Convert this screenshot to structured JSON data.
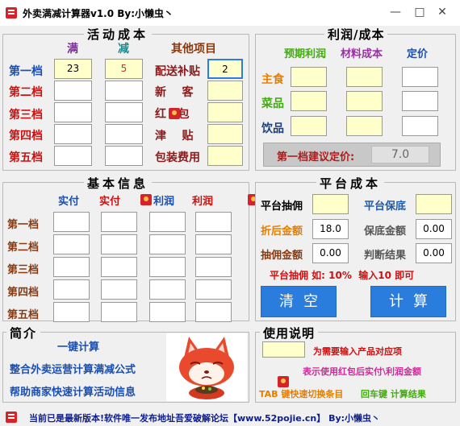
{
  "window": {
    "title": "外卖满减计算器v1.0    By:小懒虫丶",
    "minimize_glyph": "—",
    "maximize_glyph": "□",
    "close_glyph": "✕"
  },
  "activity_cost": {
    "title": "活动成本",
    "col_full": "满",
    "col_minus": "减",
    "col_other": "其他项目",
    "tiers": [
      {
        "label": "第一档",
        "full": "23",
        "minus": "5"
      },
      {
        "label": "第二档",
        "full": "",
        "minus": ""
      },
      {
        "label": "第三档",
        "full": "",
        "minus": ""
      },
      {
        "label": "第四档",
        "full": "",
        "minus": ""
      },
      {
        "label": "第五档",
        "full": "",
        "minus": ""
      }
    ],
    "other_items": [
      {
        "label": "配送补贴",
        "value": "2"
      },
      {
        "label": "新    客",
        "value": ""
      },
      {
        "label": "红   包",
        "value": ""
      },
      {
        "label": "津    贴",
        "value": ""
      },
      {
        "label": "包装费用",
        "value": ""
      }
    ]
  },
  "profit_cost": {
    "title": "利润/成本",
    "col_expected_profit": "预期利润",
    "col_material_cost": "材料成本",
    "col_price": "定价",
    "rows": [
      {
        "label": "主食",
        "profit": "",
        "material": "",
        "price": ""
      },
      {
        "label": "菜品",
        "profit": "",
        "material": "",
        "price": ""
      },
      {
        "label": "饮品",
        "profit": "",
        "material": "",
        "price": ""
      }
    ],
    "suggest_label": "第一档建议定价:",
    "suggest_value": "7.0"
  },
  "basic_info": {
    "title": "基本信息",
    "col_actual_pay": "实付",
    "col_actual_pay_rp": "实付",
    "col_profit": "利润",
    "col_profit_rp": "利润",
    "rows": [
      "第一档",
      "第二档",
      "第三档",
      "第四档",
      "第五档"
    ]
  },
  "platform_cost": {
    "title": "平台成本",
    "commission_label": "平台抽佣",
    "commission_value": "",
    "min_guarantee_label": "平台保底",
    "min_guarantee_value": "",
    "discounted_amount_label": "折后金额",
    "discounted_amount_value": "18.0",
    "guarantee_amount_label": "保底金额",
    "guarantee_amount_value": "0.00",
    "commission_amount_label": "抽佣金额",
    "commission_amount_value": "0.00",
    "judge_label": "判断结果",
    "judge_value": "0.00",
    "hint": "平台抽佣 如: 10%  输入10 即可",
    "clear_button": "清空",
    "calc_button": "计算"
  },
  "intro": {
    "title": "简介",
    "line1": "一键计算",
    "line2": "整合外卖运营计算满减公式",
    "line3": "帮助商家快速计算活动信息"
  },
  "usage": {
    "title": "使用说明",
    "legend1": "为需要输入产品对应项",
    "legend2": "表示使用红包后实付\\利润金额",
    "tab_hint_1": "TAB 键快速切换条目",
    "tab_hint_2": "回车键 计算结果"
  },
  "status": {
    "text": "当前已是最新版本!软件唯一发布地址吾爱破解论坛【www.52pojie.cn】    By:小懒虫丶"
  },
  "colors": {
    "accent_blue": "#2a7ddc",
    "input_yellow": "#ffffcc",
    "label_red": "#cc1111"
  }
}
